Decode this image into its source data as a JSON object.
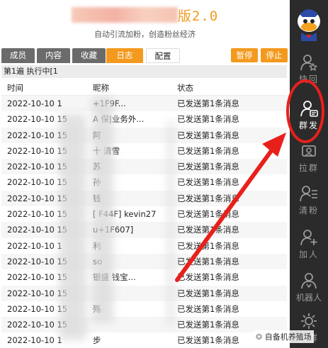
{
  "header": {
    "title_suffix": "版2.0",
    "subtitle": "自动引流加粉，创造粉丝经济"
  },
  "tabs": [
    {
      "label": "成员",
      "active": false
    },
    {
      "label": "内容",
      "active": false
    },
    {
      "label": "收藏",
      "active": false
    },
    {
      "label": "日志",
      "active": true
    },
    {
      "label": "配置",
      "active": false
    }
  ],
  "controls": {
    "pause_label": "暂停",
    "stop_label": "停止"
  },
  "status_line": "第1遍 执行中[1",
  "table": {
    "columns": [
      "时间",
      "昵称",
      "状态"
    ],
    "rows": [
      {
        "time": "2022-10-10 1",
        "nick": "+1F9F...",
        "status": "已发送第1条消息"
      },
      {
        "time": "2022-10-10 15",
        "nick": "A   保|业务外...",
        "status": "已发送第1条消息"
      },
      {
        "time": "2022-10-10 15",
        "nick": "阿",
        "status": "已发送第1条消息"
      },
      {
        "time": "2022-10-10 15",
        "nick": "十  清雪",
        "status": "已发送第1条消息"
      },
      {
        "time": "2022-10-10 15",
        "nick": "苏",
        "status": "已发送第1条消息"
      },
      {
        "time": "2022-10-10 15",
        "nick": "孙",
        "status": "已发送第1条消息"
      },
      {
        "time": "2022-10-10 15",
        "nick": "钱",
        "status": "已发送第1条消息"
      },
      {
        "time": "2022-10-10 15",
        "nick": "[  F44F] kevin27",
        "status": "已发送第1条消息"
      },
      {
        "time": "2022-10-10 15",
        "nick": "  u+1F607]",
        "status": "已发送第1条消息"
      },
      {
        "time": "2022-10-10 1",
        "nick": "  利",
        "status": "已发送第1条消息"
      },
      {
        "time": "2022-10-10 15",
        "nick": "  so",
        "status": "已发送第1条消息"
      },
      {
        "time": "2022-10-10 15",
        "nick": "  银盛 钱宝...",
        "status": "已发送第1条消息"
      },
      {
        "time": "2022-10-10 15",
        "nick": "",
        "status": "已发送第1条消息"
      },
      {
        "time": "2022-10-10 15",
        "nick": "  殇",
        "status": "已发送第1条消息"
      },
      {
        "time": "2022-10-10 15",
        "nick": "",
        "status": "已发送第1条消息"
      },
      {
        "time": "2022-10-10 1",
        "nick": "  步",
        "status": "已发送第1条消息"
      }
    ]
  },
  "sidebar": {
    "items": [
      {
        "label": "快回",
        "icon": "star-user-icon",
        "active": false
      },
      {
        "label": "群发",
        "icon": "user-message-icon",
        "active": true
      },
      {
        "label": "拉群",
        "icon": "group-icon",
        "active": false
      },
      {
        "label": "清粉",
        "icon": "user-list-icon",
        "active": false
      },
      {
        "label": "加人",
        "icon": "add-user-icon",
        "active": false
      },
      {
        "label": "机器人",
        "icon": "robot-icon",
        "active": false
      },
      {
        "label": "换群",
        "icon": "gear-icon",
        "active": false
      }
    ]
  },
  "watermark": "自备机养殖场",
  "colors": {
    "accent": "#f39a1e",
    "sidebar": "#2b2b2b",
    "annotation": "#e8201c"
  }
}
